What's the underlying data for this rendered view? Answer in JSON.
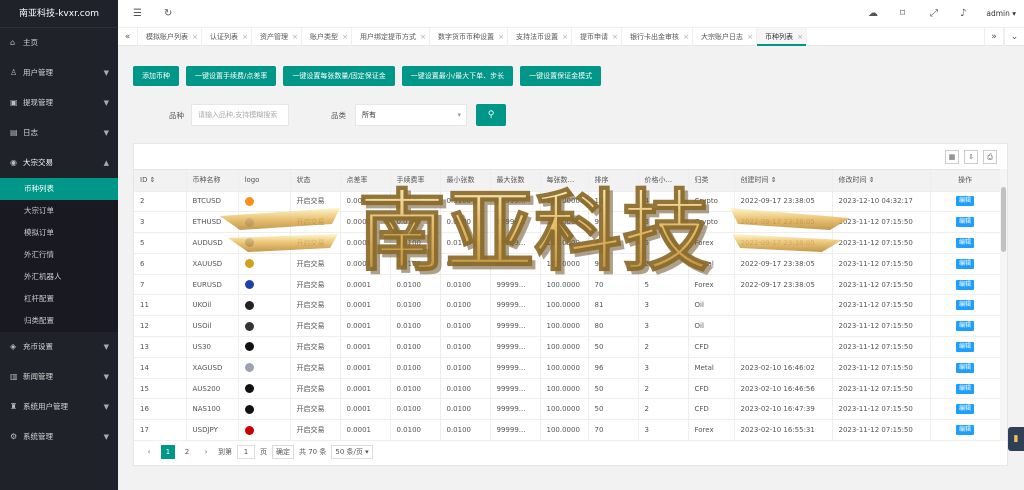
{
  "app": {
    "title": "南亚科技-kvxr.com"
  },
  "header": {
    "user": "admin"
  },
  "sidebar": {
    "items": [
      {
        "label": "主页",
        "icon": "home-icon",
        "glyph": "⌂",
        "expandable": false
      },
      {
        "label": "用户管理",
        "icon": "user-icon",
        "glyph": "♙",
        "expandable": true
      },
      {
        "label": "提现管理",
        "icon": "wallet-icon",
        "glyph": "▣",
        "expandable": true
      },
      {
        "label": "日志",
        "icon": "log-icon",
        "glyph": "▤",
        "expandable": true
      },
      {
        "label": "大宗交易",
        "icon": "trade-icon",
        "glyph": "◉",
        "expandable": true,
        "open": true
      },
      {
        "label": "充币设置",
        "icon": "coin-icon",
        "glyph": "◈",
        "expandable": true
      },
      {
        "label": "新闻管理",
        "icon": "news-icon",
        "glyph": "▥",
        "expandable": true
      },
      {
        "label": "系统用户管理",
        "icon": "admin-user-icon",
        "glyph": "♜",
        "expandable": true
      },
      {
        "label": "系统管理",
        "icon": "gear-icon",
        "glyph": "⚙",
        "expandable": true
      }
    ],
    "sub": [
      {
        "label": "币种列表",
        "active": true
      },
      {
        "label": "大宗订单"
      },
      {
        "label": "模拟订单"
      },
      {
        "label": "外汇行情"
      },
      {
        "label": "外汇机器人"
      },
      {
        "label": "杠杆配置"
      },
      {
        "label": "归类配置"
      }
    ]
  },
  "tabs": [
    {
      "label": "模拟账户列表"
    },
    {
      "label": "认证列表"
    },
    {
      "label": "资产管理"
    },
    {
      "label": "账户类型"
    },
    {
      "label": "用户绑定提币方式"
    },
    {
      "label": "数字货币币种设置"
    },
    {
      "label": "支持法币设置"
    },
    {
      "label": "提币申请"
    },
    {
      "label": "银行卡出金审核"
    },
    {
      "label": "大宗账户日志"
    },
    {
      "label": "币种列表",
      "active": true
    }
  ],
  "toolbar": {
    "buttons": [
      "添加币种",
      "一键设置手续费/点差率",
      "一键设置每张数量/固定保证金",
      "一键设置最小/最大下单、步长",
      "一键设置保证金模式"
    ]
  },
  "search": {
    "label_name": "品种",
    "placeholder": "请输入品种,支持模糊搜索",
    "label_category": "品类",
    "category_value": "所有"
  },
  "table": {
    "columns": [
      "ID ⇕",
      "币种名称",
      "logo",
      "状态",
      "点差率",
      "手续费率",
      "最小张数",
      "最大张数",
      "每张数...",
      "排序",
      "价格小...",
      "归类",
      "创建时间 ⇕",
      "修改时间 ⇕",
      "操作"
    ],
    "edit_label": "编辑",
    "rows": [
      {
        "id": "2",
        "name": "BTCUSD",
        "status": "开启交易",
        "spread": "0.0000",
        "fee": "0.0100",
        "min": "0.0100",
        "max": "99999...",
        "per": "100.0000",
        "sort": "10",
        "dec": "4",
        "cat": "Crypto",
        "created": "2022-09-17 23:38:05",
        "modified": "2023-12-10 04:32:17",
        "color": "#f7931a"
      },
      {
        "id": "3",
        "name": "ETHUSD",
        "status": "开启交易",
        "spread": "0.0000",
        "fee": "0.0100",
        "min": "0.0100",
        "max": "99999...",
        "per": "100.0000",
        "sort": "9",
        "dec": "3",
        "cat": "Crypto",
        "created": "2022-09-17 23:38:05",
        "modified": "2023-11-12 07:15:50",
        "color": "#627eea"
      },
      {
        "id": "5",
        "name": "AUDUSD",
        "status": "开启交易",
        "spread": "0.0001",
        "fee": "0.0100",
        "min": "0.0100",
        "max": "99999...",
        "per": "100.0000",
        "sort": "8",
        "dec": "5",
        "cat": "Forex",
        "created": "2022-09-17 23:38:05",
        "modified": "2023-11-12 07:15:50",
        "color": "#1e3a8a"
      },
      {
        "id": "6",
        "name": "XAUUSD",
        "status": "开启交易",
        "spread": "0.0001",
        "fee": "0.0100",
        "min": "0.0100",
        "max": "99999...",
        "per": "100.0000",
        "sort": "9",
        "dec": "2",
        "cat": "Metal",
        "created": "2022-09-17 23:38:05",
        "modified": "2023-11-12 07:15:50",
        "color": "#d4a017"
      },
      {
        "id": "7",
        "name": "EURUSD",
        "status": "开启交易",
        "spread": "0.0001",
        "fee": "0.0100",
        "min": "0.0100",
        "max": "99999...",
        "per": "100.0000",
        "sort": "70",
        "dec": "5",
        "cat": "Forex",
        "created": "2022-09-17 23:38:05",
        "modified": "2023-11-12 07:15:50",
        "color": "#1e40af"
      },
      {
        "id": "11",
        "name": "UKOil",
        "status": "开启交易",
        "spread": "0.0001",
        "fee": "0.0100",
        "min": "0.0100",
        "max": "99999...",
        "per": "100.0000",
        "sort": "81",
        "dec": "3",
        "cat": "Oil",
        "created": "",
        "modified": "2023-11-12 07:15:50",
        "color": "#222"
      },
      {
        "id": "12",
        "name": "USOil",
        "status": "开启交易",
        "spread": "0.0001",
        "fee": "0.0100",
        "min": "0.0100",
        "max": "99999...",
        "per": "100.0000",
        "sort": "80",
        "dec": "3",
        "cat": "Oil",
        "created": "",
        "modified": "2023-11-12 07:15:50",
        "color": "#333"
      },
      {
        "id": "13",
        "name": "US30",
        "status": "开启交易",
        "spread": "0.0001",
        "fee": "0.0100",
        "min": "0.0100",
        "max": "99999...",
        "per": "100.0000",
        "sort": "50",
        "dec": "2",
        "cat": "CFD",
        "created": "",
        "modified": "2023-11-12 07:15:50",
        "color": "#111"
      },
      {
        "id": "14",
        "name": "XAGUSD",
        "status": "开启交易",
        "spread": "0.0001",
        "fee": "0.0100",
        "min": "0.0100",
        "max": "99999...",
        "per": "100.0000",
        "sort": "96",
        "dec": "3",
        "cat": "Metal",
        "created": "2023-02-10 16:46:02",
        "modified": "2023-11-12 07:15:50",
        "color": "#9ca3af"
      },
      {
        "id": "15",
        "name": "AUS200",
        "status": "开启交易",
        "spread": "0.0001",
        "fee": "0.0100",
        "min": "0.0100",
        "max": "99999...",
        "per": "100.0000",
        "sort": "50",
        "dec": "2",
        "cat": "CFD",
        "created": "2023-02-10 16:46:56",
        "modified": "2023-11-12 07:15:50",
        "color": "#111"
      },
      {
        "id": "16",
        "name": "NAS100",
        "status": "开启交易",
        "spread": "0.0001",
        "fee": "0.0100",
        "min": "0.0100",
        "max": "99999...",
        "per": "100.0000",
        "sort": "50",
        "dec": "2",
        "cat": "CFD",
        "created": "2023-02-10 16:47:39",
        "modified": "2023-11-12 07:15:50",
        "color": "#111"
      },
      {
        "id": "17",
        "name": "USDJPY",
        "status": "开启交易",
        "spread": "0.0001",
        "fee": "0.0100",
        "min": "0.0100",
        "max": "99999...",
        "per": "100.0000",
        "sort": "70",
        "dec": "3",
        "cat": "Forex",
        "created": "2023-02-10 16:55:31",
        "modified": "2023-11-12 07:15:50",
        "color": "#c00"
      }
    ]
  },
  "pager": {
    "pages": [
      "1",
      "2"
    ],
    "goto_label": "到第",
    "page_value": "1",
    "page_suffix": "页",
    "ok_label": "确定",
    "total": "共 70 条",
    "size": "50 条/页"
  },
  "watermark": {
    "text": "南亚科技"
  }
}
